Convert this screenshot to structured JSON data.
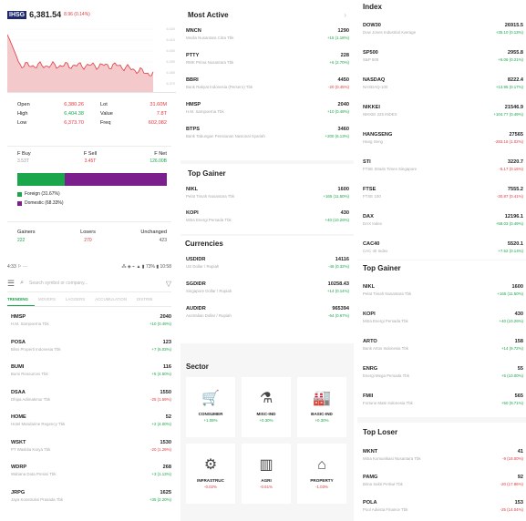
{
  "colors": {
    "green": "#1aa64a",
    "red": "#e0393e",
    "purple": "#7a1f8c",
    "badge": "#1f2a6e"
  },
  "ihsg": {
    "badge": "IHSG",
    "value": "6,381.54",
    "change": "8.96 (0.14%)",
    "chart_axis": [
      "6,420",
      "6,410",
      "6,400",
      "6,390",
      "6,380",
      "6,370"
    ],
    "stats": [
      {
        "label": "Open",
        "value": "6,380.26",
        "label2": "Lot",
        "value2": "31.60M"
      },
      {
        "label": "High",
        "value": "6,404.38",
        "label2": "Value",
        "value2": "7.8T"
      },
      {
        "label": "Low",
        "value": "6,373.70",
        "label2": "Freq",
        "value2": "602,082"
      }
    ],
    "flow": {
      "fbuy_label": "F Buy",
      "fbuy_value": "3.53T",
      "fsell_label": "F Sell",
      "fsell_value": "3.45T",
      "fnet_label": "F Net",
      "fnet_value": "126.00B",
      "foreign_ratio": 0.317,
      "legend_foreign": "Foreign (31.67%)",
      "legend_domestic": "Domestic (68.33%)"
    },
    "breadth": {
      "gainers_label": "Gainers",
      "gainers_value": "222",
      "losers_label": "Losers",
      "losers_value": "270",
      "unchanged_label": "Unchanged",
      "unchanged_value": "423"
    }
  },
  "phone": {
    "statusbar_left": "4:33 ⚐ ···",
    "statusbar_right": "⁂ ◈ ⌁ ▲ ▮ 73% ▮ 10:58",
    "search_placeholder": "Search symbol or company...",
    "tabs": [
      "TRENDING",
      "MOVERS",
      "LAGGERS",
      "ACCUMULATION",
      "DISTRIB"
    ],
    "stocks": [
      {
        "code": "HMSP",
        "name": "H.M. Sampoerna Tbk",
        "price": "2040",
        "change": "+10 (0.49%)",
        "dir": "up"
      },
      {
        "code": "POSA",
        "name": "Bliss Properti Indonesia Tbk",
        "price": "123",
        "change": "+7 (6.03%)",
        "dir": "up"
      },
      {
        "code": "BUMI",
        "name": "Bumi Resources Tbk",
        "price": "116",
        "change": "+5 (4.50%)",
        "dir": "up"
      },
      {
        "code": "DSAA",
        "name": "Dhipa Adimakmur Tbk",
        "price": "1550",
        "change": "-25 (1.59%)",
        "dir": "down"
      },
      {
        "code": "HOME",
        "name": "Hotel Mandarine Regency Tbk",
        "price": "52",
        "change": "+2 (4.00%)",
        "dir": "up"
      },
      {
        "code": "WSKT",
        "name": "PT Waskita Karya Tbk",
        "price": "1530",
        "change": "-20 (1.29%)",
        "dir": "down"
      },
      {
        "code": "WDRP",
        "name": "Wahana Duta Presisi Tbk",
        "price": "268",
        "change": "+3 (1.13%)",
        "dir": "up"
      },
      {
        "code": "JRPG",
        "name": "Jaya Konstruksi Prasada Tbk",
        "price": "1625",
        "change": "+35 (2.20%)",
        "dir": "up"
      }
    ]
  },
  "most_active": {
    "title": "Most Active",
    "items": [
      {
        "code": "MNCN",
        "name": "Media Nusantara Citra Tbk",
        "price": "1290",
        "change": "+15 (1.18%)",
        "dir": "up"
      },
      {
        "code": "PTTY",
        "name": "RMK Prima Nusantara Tbk",
        "price": "228",
        "change": "+6 (2.70%)",
        "dir": "up"
      },
      {
        "code": "BBRI",
        "name": "Bank Rakyat Indonesia (Persero) Tbk",
        "price": "4450",
        "change": "-20 (0.45%)",
        "dir": "down"
      },
      {
        "code": "HMSP",
        "name": "H.M. Sampoerna Tbk",
        "price": "2040",
        "change": "+10 (0.49%)",
        "dir": "up"
      },
      {
        "code": "BTPS",
        "name": "Bank Tabungan Pensiunan Nasional Syariah",
        "price": "3460",
        "change": "+200 (6.13%)",
        "dir": "up"
      }
    ]
  },
  "top_gainer_mid": {
    "title": "Top Gainer",
    "items": [
      {
        "code": "NIKL",
        "name": "Pelat Timah Nusantara Tbk",
        "price": "1600",
        "change": "+165 (11.50%)",
        "dir": "up"
      },
      {
        "code": "KOPI",
        "name": "Mitra Energi Persada Tbk",
        "price": "430",
        "change": "+40 (10.26%)",
        "dir": "up"
      }
    ]
  },
  "currencies": {
    "title": "Currencies",
    "items": [
      {
        "code": "USDIDR",
        "name": "US Dollar / Rupiah",
        "price": "14116",
        "change": "-46 (0.32%)",
        "dir": "up"
      },
      {
        "code": "SGDIDR",
        "name": "Singapore Dollar / Rupiah",
        "price": "10258.43",
        "change": "+14 (0.14%)",
        "dir": "up"
      },
      {
        "code": "AUDIDR",
        "name": "Australian Dollar / Rupiah",
        "price": "965394",
        "change": "-64 (0.67%)",
        "dir": "up"
      }
    ]
  },
  "sector": {
    "title": "Sector",
    "items": [
      {
        "name": "CONSUMER",
        "change": "+1.08%",
        "dir": "up",
        "icon": "cart-icon"
      },
      {
        "name": "MISC-IND",
        "change": "+0.30%",
        "dir": "up",
        "icon": "lab-icon"
      },
      {
        "name": "BASIC-IND",
        "change": "+0.30%",
        "dir": "up",
        "icon": "factory-icon"
      },
      {
        "name": "INFRASTRUC",
        "change": "-0.02%",
        "dir": "down",
        "icon": "tower-icon"
      },
      {
        "name": "AGRI",
        "change": "-0.61%",
        "dir": "down",
        "icon": "plant-icon"
      },
      {
        "name": "PROPERTY",
        "change": "-1.03%",
        "dir": "down",
        "icon": "house-icon"
      }
    ]
  },
  "index": {
    "title": "Index",
    "items": [
      {
        "code": "DOW30",
        "name": "Dow Jones Industrial Average",
        "price": "26915.5",
        "change": "+35.10 (0.13%)",
        "dir": "up"
      },
      {
        "code": "SP500",
        "name": "S&P 500",
        "price": "2955.8",
        "change": "+6.06 (0.21%)",
        "dir": "up"
      },
      {
        "code": "NASDAQ",
        "name": "NASDAQ-100",
        "price": "8222.4",
        "change": "+13.95 (0.17%)",
        "dir": "up"
      },
      {
        "code": "NIKKEI",
        "name": "NIKKEI 225 INDEX",
        "price": "21546.9",
        "change": "+104.77 (0.49%)",
        "dir": "up"
      },
      {
        "code": "HANGSENG",
        "name": "Hang Seng",
        "price": "27565",
        "change": "-283.16 (1.02%)",
        "dir": "down"
      },
      {
        "code": "STI",
        "name": "FTSE Straits Times Singapore",
        "price": "3220.7",
        "change": "-5.17 (0.16%)",
        "dir": "down"
      },
      {
        "code": "FTSE",
        "name": "FTSE 100",
        "price": "7555.2",
        "change": "-30.87 (0.41%)",
        "dir": "down"
      },
      {
        "code": "DAX",
        "name": "DAX Index",
        "price": "12196.1",
        "change": "+59.03 (0.49%)",
        "dir": "up"
      },
      {
        "code": "CAC40",
        "name": "CAC 40 Index",
        "price": "5520.1",
        "change": "+7.52 (0.14%)",
        "dir": "up"
      }
    ]
  },
  "top_gainer_right": {
    "title": "Top Gainer",
    "items": [
      {
        "code": "NIKL",
        "name": "Pelat Timah Nusantara Tbk",
        "price": "1600",
        "change": "+165 (11.50%)",
        "dir": "up"
      },
      {
        "code": "KOPI",
        "name": "Mitra Energi Persada Tbk",
        "price": "430",
        "change": "+40 (10.26%)",
        "dir": "up"
      },
      {
        "code": "ARTO",
        "name": "Bank Artos Indonesia Tbk",
        "price": "158",
        "change": "+14 (9.72%)",
        "dir": "up"
      },
      {
        "code": "ENRG",
        "name": "Energi Mega Persada Tbk",
        "price": "55",
        "change": "+5 (10.00%)",
        "dir": "up"
      },
      {
        "code": "FMII",
        "name": "Fortune Mate Indonesia Tbk",
        "price": "565",
        "change": "+50 (9.71%)",
        "dir": "up"
      }
    ]
  },
  "top_loser": {
    "title": "Top Loser",
    "items": [
      {
        "code": "MKNT",
        "name": "Mitra Komunikasi Nusantara Tbk",
        "price": "41",
        "change": "-9 (18.00%)",
        "dir": "down"
      },
      {
        "code": "PAMG",
        "name": "Bima Sakti Pertiwi Tbk",
        "price": "92",
        "change": "-20 (17.86%)",
        "dir": "down"
      },
      {
        "code": "POLA",
        "name": "Pool Advista Finance Tbk",
        "price": "153",
        "change": "-25 (14.04%)",
        "dir": "down"
      }
    ]
  }
}
